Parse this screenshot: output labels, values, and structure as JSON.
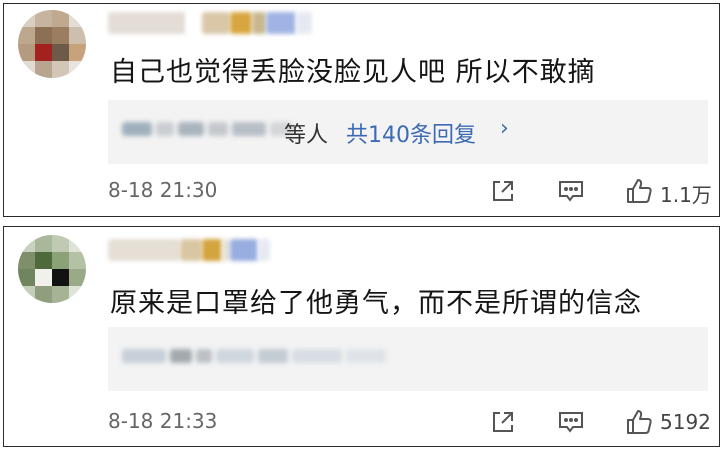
{
  "comments": [
    {
      "text": "自己也觉得丢脸没脸见人吧 所以不敢摘",
      "reply_suffix": "等人",
      "reply_count_label": "共140条回复",
      "reply_chevron": "›",
      "timestamp": "8-18 21:30",
      "like_count": "1.1万",
      "icons": [
        "share-icon",
        "comment-icon",
        "like-icon"
      ]
    },
    {
      "text": "原来是口罩给了他勇气，而不是所谓的信念",
      "timestamp": "8-18 21:33",
      "like_count": "5192",
      "icons": [
        "share-icon",
        "comment-icon",
        "like-icon"
      ]
    }
  ],
  "colors": {
    "link_blue": "#3d6bb3",
    "reply_bg": "#f3f3f3",
    "meta_gray": "#666666"
  }
}
